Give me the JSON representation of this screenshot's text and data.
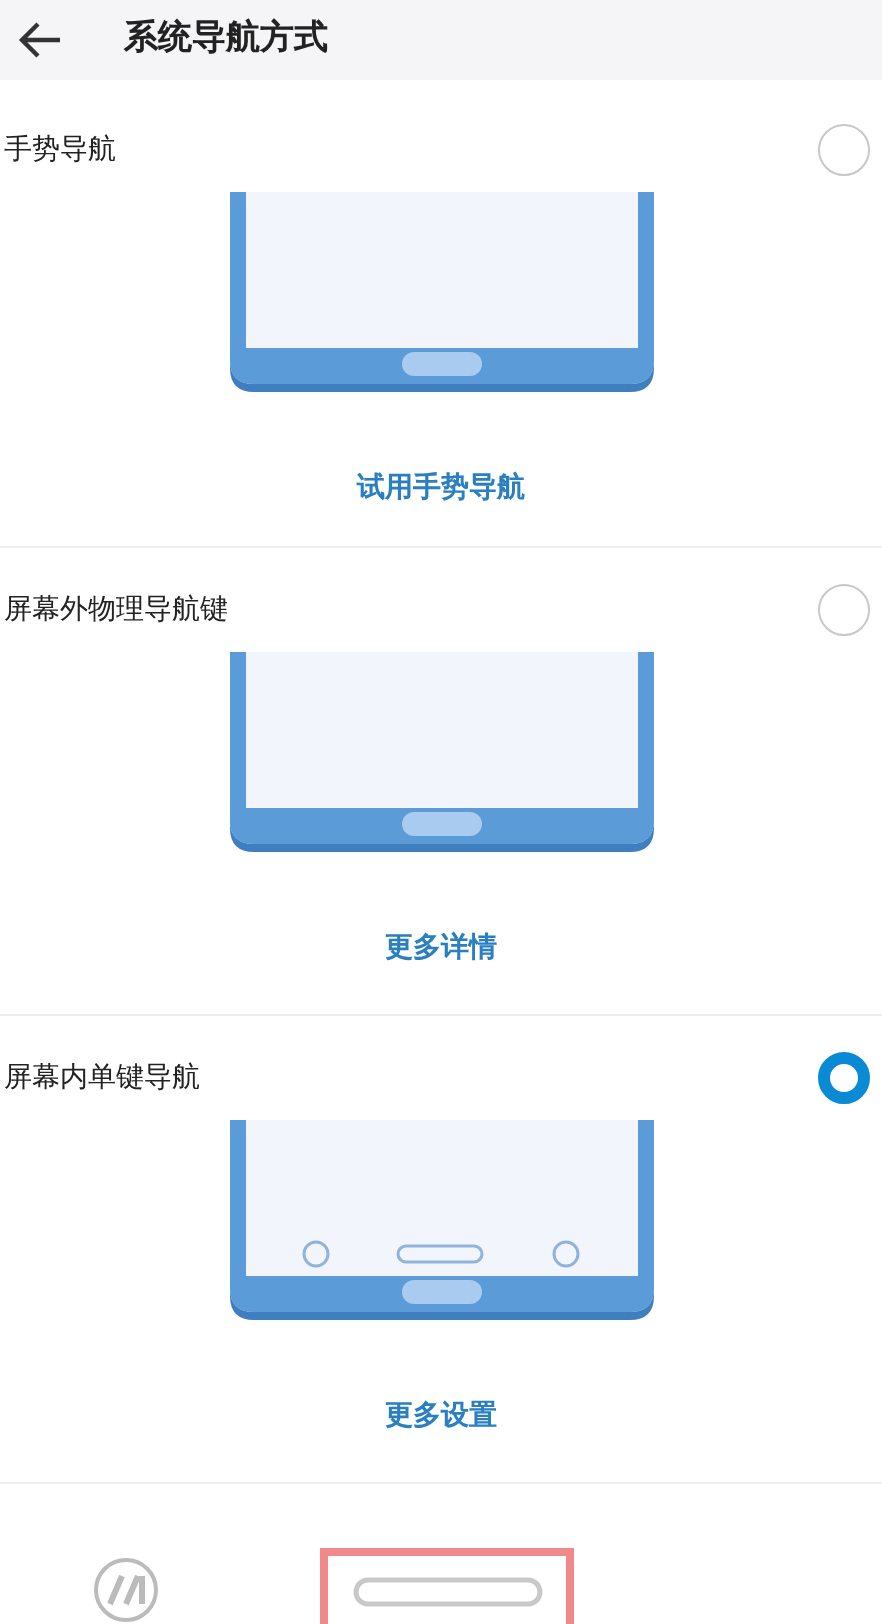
{
  "header": {
    "title": "系统导航方式"
  },
  "options": [
    {
      "title": "手势导航",
      "selected": false,
      "kind": "gesture",
      "link": "试用手势导航"
    },
    {
      "title": "屏幕外物理导航键",
      "selected": false,
      "kind": "physical",
      "link": "更多详情"
    },
    {
      "title": "屏幕内单键导航",
      "selected": true,
      "kind": "onscreen",
      "link": "更多设置"
    }
  ]
}
